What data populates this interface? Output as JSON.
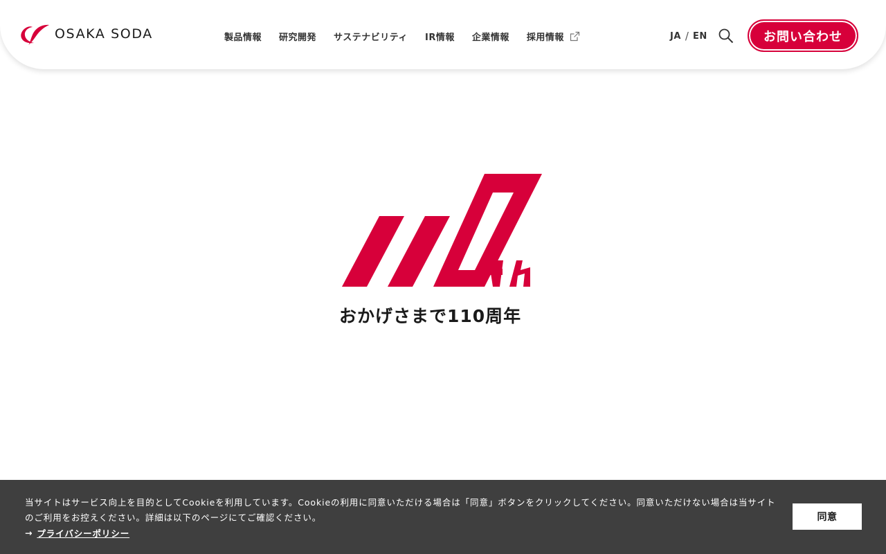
{
  "header": {
    "logo_text": "OSAKA SODA",
    "nav": [
      {
        "label": "製品情報"
      },
      {
        "label": "研究開発"
      },
      {
        "label": "サステナビリティ"
      },
      {
        "label": "IR情報"
      },
      {
        "label": "企業情報"
      },
      {
        "label": "採用情報",
        "external": true
      }
    ],
    "lang": {
      "ja": "JA",
      "separator": "/",
      "en": "EN"
    },
    "contact_label": "お問い合わせ"
  },
  "hero": {
    "logo_text": "110th",
    "tagline": "おかげさまで110周年"
  },
  "cookie": {
    "message": "当サイトはサービス向上を目的としてCookieを利用しています。Cookieの利用に同意いただける場合は「同意」ボタンをクリックしてください。同意いただけない場合は当サイトのご利用をお控えください。詳細は以下のページにてご確認ください。",
    "arrow": "→",
    "policy_link": "プライバシーポリシー",
    "agree_label": "同意"
  },
  "colors": {
    "brand_red": "#d7003a",
    "cookie_bg": "#3f3f3f"
  }
}
